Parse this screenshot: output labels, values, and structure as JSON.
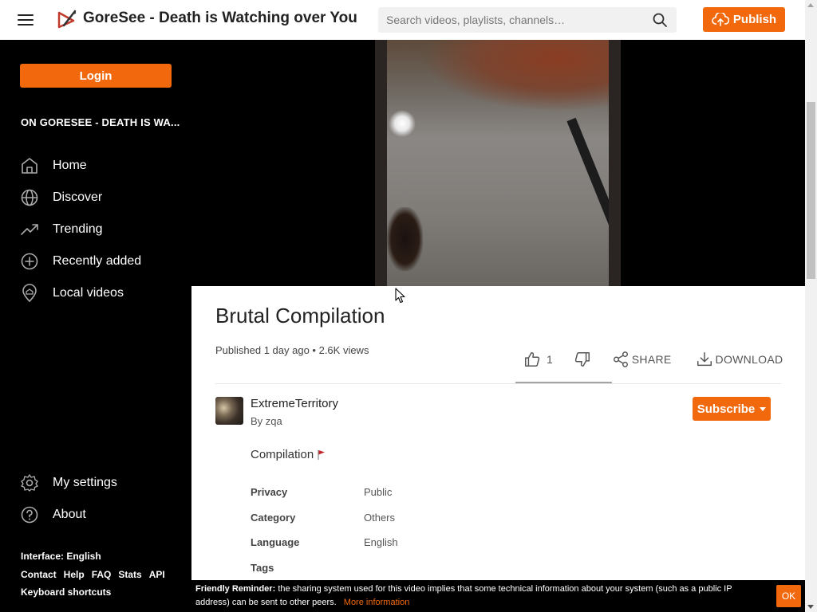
{
  "header": {
    "site_title": "GoreSee - Death is Watching over You",
    "search_placeholder": "Search videos, playlists, channels…",
    "publish_label": "Publish"
  },
  "sidebar": {
    "login_label": "Login",
    "heading": "ON GORESEE - DEATH IS WA...",
    "nav": [
      {
        "label": "Home",
        "icon": "home-icon"
      },
      {
        "label": "Discover",
        "icon": "globe-icon"
      },
      {
        "label": "Trending",
        "icon": "trending-icon"
      },
      {
        "label": "Recently added",
        "icon": "plus-circle-icon"
      },
      {
        "label": "Local videos",
        "icon": "location-icon"
      }
    ],
    "bottom_nav": [
      {
        "label": "My settings",
        "icon": "gear-icon"
      },
      {
        "label": "About",
        "icon": "help-icon"
      }
    ],
    "footer": {
      "interface": "Interface: English",
      "links": [
        "Contact",
        "Help",
        "FAQ",
        "Stats",
        "API"
      ],
      "shortcuts": "Keyboard shortcuts"
    }
  },
  "video": {
    "title": "Brutal Compilation",
    "meta": "Published 1 day ago • 2.6K views",
    "likes": "1",
    "share_label": "SHARE",
    "download_label": "DOWNLOAD"
  },
  "channel": {
    "name": "ExtremeTerritory",
    "by_prefix": "By",
    "user": "zqa",
    "subscribe_label": "Subscribe"
  },
  "description": "Compilation",
  "details": [
    {
      "label": "Privacy",
      "value": "Public"
    },
    {
      "label": "Category",
      "value": "Others"
    },
    {
      "label": "Language",
      "value": "English"
    },
    {
      "label": "Tags",
      "value": ""
    }
  ],
  "reminder": {
    "title": "Friendly Reminder:",
    "text": "the sharing system used for this video implies that some technical information about your system (such as a public IP address) can be sent to other peers.",
    "more_info": "More information",
    "ok_label": "OK"
  },
  "colors": {
    "accent": "#f2690d",
    "sidebar_bg": "#000000",
    "content_bg": "#ffffff"
  }
}
